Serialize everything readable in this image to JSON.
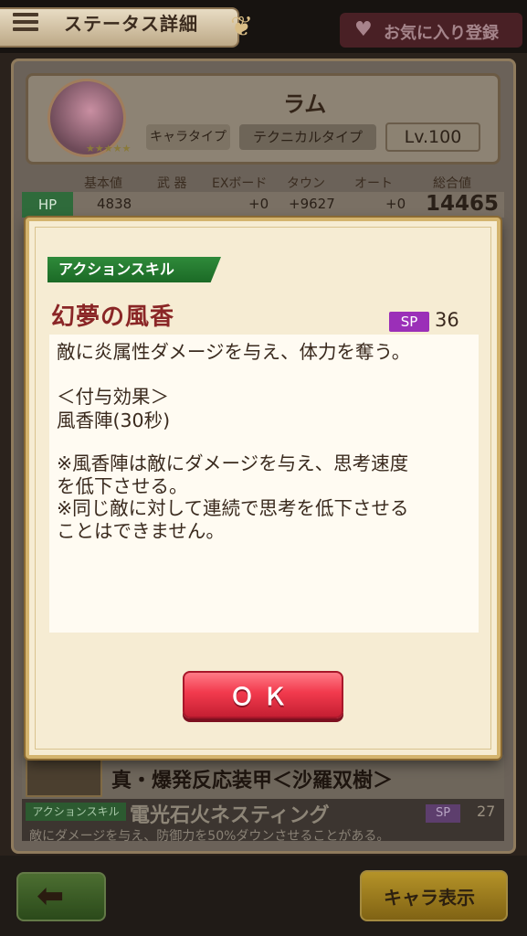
{
  "header": {
    "title": "ステータス詳細",
    "favorite_label": "お気に入り登録"
  },
  "character": {
    "name": "ラム",
    "type_label": "キャラタイプ",
    "type_value": "テクニカルタイプ",
    "level": "Lv.100",
    "stars": "★★★★★"
  },
  "stats": {
    "headers": [
      "基本値",
      "武 器",
      "EXボード",
      "タウン",
      "オート",
      "総合値"
    ],
    "hp": {
      "label": "HP",
      "base": "4838",
      "ex": "+0",
      "town": "+9627",
      "auto": "+0",
      "total": "14465"
    }
  },
  "equipment": {
    "name": "真・爆発反応装甲＜沙羅双樹＞",
    "skill_tag": "アクションスキル",
    "skill_name": "電光石火ネスティング",
    "skill_sp_label": "SP",
    "skill_sp": "27",
    "skill_desc": "敵にダメージを与え、防御力を50%ダウンさせることがある。"
  },
  "footer": {
    "back_icon": "arrow-left-icon",
    "chara_button": "キャラ表示"
  },
  "modal": {
    "tag": "アクションスキル",
    "skill_name": "幻夢の風香",
    "sp_label": "SP",
    "sp_value": "36",
    "description_lines": [
      "敵に炎属性ダメージを与え、体力を奪う。",
      "",
      "＜付与効果＞",
      "風香陣(30秒)",
      "",
      "※風香陣は敵にダメージを与え、思考速度",
      "を低下させる。",
      "※同じ敵に対して連続で思考を低下させる",
      "ことはできません。"
    ],
    "ok_label": "ＯＫ"
  }
}
